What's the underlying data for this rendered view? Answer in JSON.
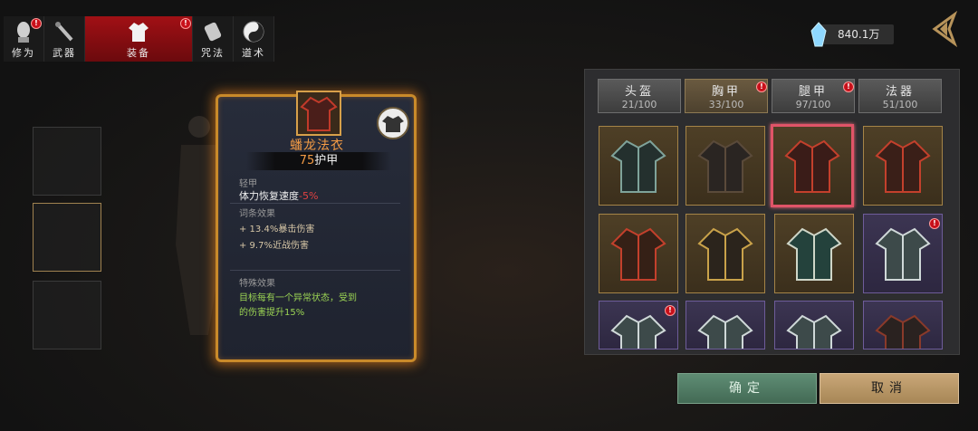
{
  "nav": {
    "tabs": [
      {
        "label": "修为",
        "icon": "cultivator-head-icon",
        "badge": "!"
      },
      {
        "label": "武器",
        "icon": "weapon-icon",
        "badge": ""
      },
      {
        "label": "装备",
        "icon": "robe-icon",
        "badge": "!"
      },
      {
        "label": "咒法",
        "icon": "scroll-icon",
        "badge": ""
      },
      {
        "label": "道术",
        "icon": "yin-yang-icon",
        "badge": ""
      }
    ]
  },
  "currency": {
    "amount": "840.1万",
    "icon": "spirit-crystal-icon"
  },
  "tooltip": {
    "name": "蟠龙法衣",
    "armor_value": "75",
    "armor_unit": "护甲",
    "type": "轻甲",
    "stat_label": "体力恢复速度",
    "stat_value": "-5%",
    "affix_header": "词条效果",
    "affix_1": "+ 13.4%暴击伤害",
    "affix_2": "+ 9.7%近战伤害",
    "special_header": "特殊效果",
    "special_line1": "目标每有一个异常状态，受到",
    "special_line2": "的伤害提升15%"
  },
  "categories": [
    {
      "name": "头盔",
      "count": "21/100",
      "badge": ""
    },
    {
      "name": "胸甲",
      "count": "33/100",
      "badge": "!"
    },
    {
      "name": "腿甲",
      "count": "97/100",
      "badge": "!"
    },
    {
      "name": "法器",
      "count": "51/100",
      "badge": ""
    }
  ],
  "buttons": {
    "confirm": "确定",
    "cancel": "取消"
  },
  "colors": {
    "accent_orange": "#f39b45",
    "red_stat": "#e24242",
    "green_text": "#9bd454",
    "selected_border": "#e05468"
  }
}
